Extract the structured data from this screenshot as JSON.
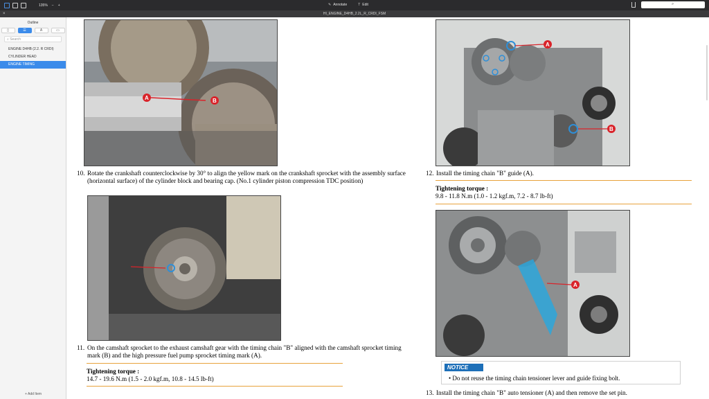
{
  "toolbar": {
    "zoom": "135%",
    "zoom_minus": "−",
    "zoom_plus": "+",
    "annotate": "Annotate",
    "edit": "Edit",
    "search_icon": "magnifier-icon"
  },
  "titlebar": {
    "filename": "HI_ENGINE_D4HB_2.2L_R_CRDI_FSM",
    "close": "×"
  },
  "sidebar": {
    "title": "Outline",
    "search_placeholder": "Search",
    "items": [
      {
        "label": "ENGINE D4HB (2.2. R CRDI)"
      },
      {
        "label": "CYLINDER HEAD"
      },
      {
        "label": "ENGINE TIMING"
      }
    ],
    "add_item": "+ Add Item"
  },
  "document": {
    "step10": {
      "num": "10.",
      "text": "Rotate the crankshaft counterclockwise by 30° to align the yellow mark on the crankshaft sprocket with the assembly surface (horizontal surface) of the cylinder block and bearing cap. (No.1 cylinder piston compression TDC position)"
    },
    "step11": {
      "num": "11.",
      "text": "On the camshaft sprocket to the exhaust camshaft gear with the timing chain \"B\" aligned with the camshaft sprocket timing mark (B) and the high pressure fuel pump sprocket timing mark (A)."
    },
    "torque11": {
      "title": "Tightening torque :",
      "value": "14.7 - 19.6 N.m (1.5 - 2.0 kgf.m, 10.8 - 14.5 lb-ft)"
    },
    "step12": {
      "num": "12.",
      "text": "Install the timing chain \"B\" guide (A)."
    },
    "torque12": {
      "title": "Tightening torque :",
      "value": "9.8 - 11.8 N.m (1.0 - 1.2 kgf.m, 7.2 - 8.7 lb-ft)"
    },
    "notice": {
      "tag": "NOTICE",
      "text": "• Do not reuse the timing chain tensioner lever and guide fixing bolt."
    },
    "step13": {
      "num": "13.",
      "text": "Install the timing chain \"B\" auto tensioner (A) and then remove the set pin."
    },
    "labels": {
      "a": "A",
      "b": "B"
    }
  },
  "colors": {
    "accent_blue": "#3b8bea",
    "orange_rule": "#e8a23a",
    "notice_blue": "#1d6fb8",
    "callout_red": "#d9232a"
  }
}
